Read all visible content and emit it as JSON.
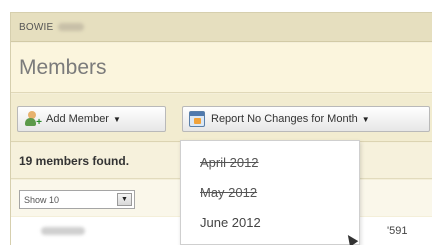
{
  "header": {
    "org_name": "BOWIE",
    "page_title": "Members"
  },
  "toolbar": {
    "add_member_label": "Add Member",
    "report_label": "Report No Changes for Month",
    "add_member_icon": "add-user-icon",
    "report_icon": "calendar-report-icon"
  },
  "results": {
    "found_text": "19 members found."
  },
  "pager": {
    "show_value": "Show 10"
  },
  "table": {
    "first_row_phone_suffix": "'591"
  },
  "month_menu": {
    "items": [
      {
        "label": "April 2012",
        "struck": true
      },
      {
        "label": "May 2012",
        "struck": true
      },
      {
        "label": "June 2012",
        "struck": false
      }
    ]
  }
}
